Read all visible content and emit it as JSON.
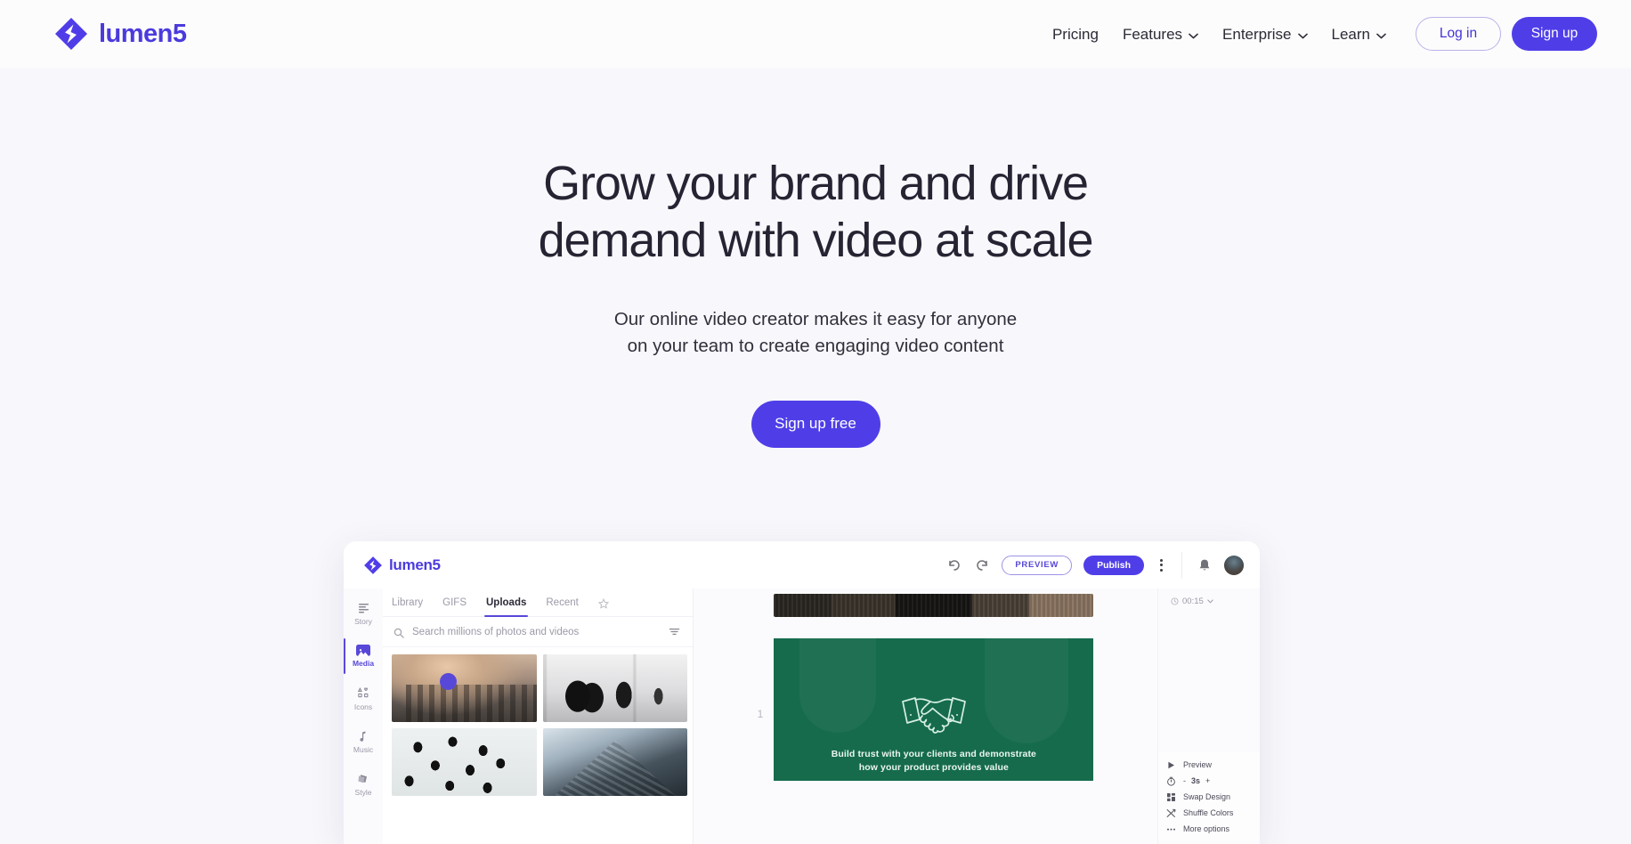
{
  "brand": {
    "name": "lumen5",
    "logo_icon": "lumen5-logo-icon",
    "accent": "#4f3ee8"
  },
  "nav": {
    "links": [
      {
        "label": "Pricing",
        "has_dropdown": false
      },
      {
        "label": "Features",
        "has_dropdown": true
      },
      {
        "label": "Enterprise",
        "has_dropdown": true
      },
      {
        "label": "Learn",
        "has_dropdown": true
      }
    ],
    "login_label": "Log in",
    "signup_label": "Sign up"
  },
  "hero": {
    "heading_line1": "Grow your brand and drive",
    "heading_line2": "demand with video at scale",
    "sub_line1": "Our online video creator makes it easy for anyone",
    "sub_line2": "on your team to create engaging video content",
    "cta_label": "Sign up free"
  },
  "mock": {
    "brand_name": "lumen5",
    "undo_icon": "undo-icon",
    "redo_icon": "redo-icon",
    "preview_label": "PREVIEW",
    "publish_label": "Publish",
    "overflow_icon": "kebab-menu-icon",
    "notification_icon": "bell-icon",
    "avatar_icon": "user-avatar",
    "rail": [
      {
        "label": "Story",
        "icon": "story-lines-icon",
        "active": false
      },
      {
        "label": "Media",
        "icon": "media-image-icon",
        "active": true
      },
      {
        "label": "Icons",
        "icon": "icons-grid-icon",
        "active": false
      },
      {
        "label": "Music",
        "icon": "music-note-icon",
        "active": false
      },
      {
        "label": "Style",
        "icon": "style-layers-icon",
        "active": false
      }
    ],
    "media_tabs": [
      {
        "label": "Library",
        "active": false
      },
      {
        "label": "GIFS",
        "active": false
      },
      {
        "label": "Uploads",
        "active": true
      },
      {
        "label": "Recent",
        "active": false
      }
    ],
    "favorite_icon": "star-icon",
    "search_placeholder": "Search millions of photos and videos",
    "search_value": "",
    "search_icon": "search-icon",
    "filter_icon": "filter-icon",
    "media_tiles": [
      {
        "name": "city-skyline-sunset"
      },
      {
        "name": "lobby-silhouettes"
      },
      {
        "name": "crowd-from-above"
      },
      {
        "name": "glass-tower-upward"
      }
    ],
    "slide_number": "1",
    "slide_caption_line1": "Build trust with your clients and demonstrate",
    "slide_caption_line2": "how your product provides value",
    "slide_illustration": "handshake-icon",
    "slide_bg_color": "#166b4d",
    "duration": "00:15",
    "duration_icon": "clock-icon",
    "context_menu": [
      {
        "label": "Preview",
        "icon": "play-icon"
      },
      {
        "label": "3s",
        "icon": "timer-icon",
        "type": "stepper",
        "minus": "-",
        "plus": "+"
      },
      {
        "label": "Swap Design",
        "icon": "layout-grid-icon"
      },
      {
        "label": "Shuffle Colors",
        "icon": "shuffle-icon"
      },
      {
        "label": "More options",
        "icon": "ellipsis-icon"
      }
    ]
  }
}
